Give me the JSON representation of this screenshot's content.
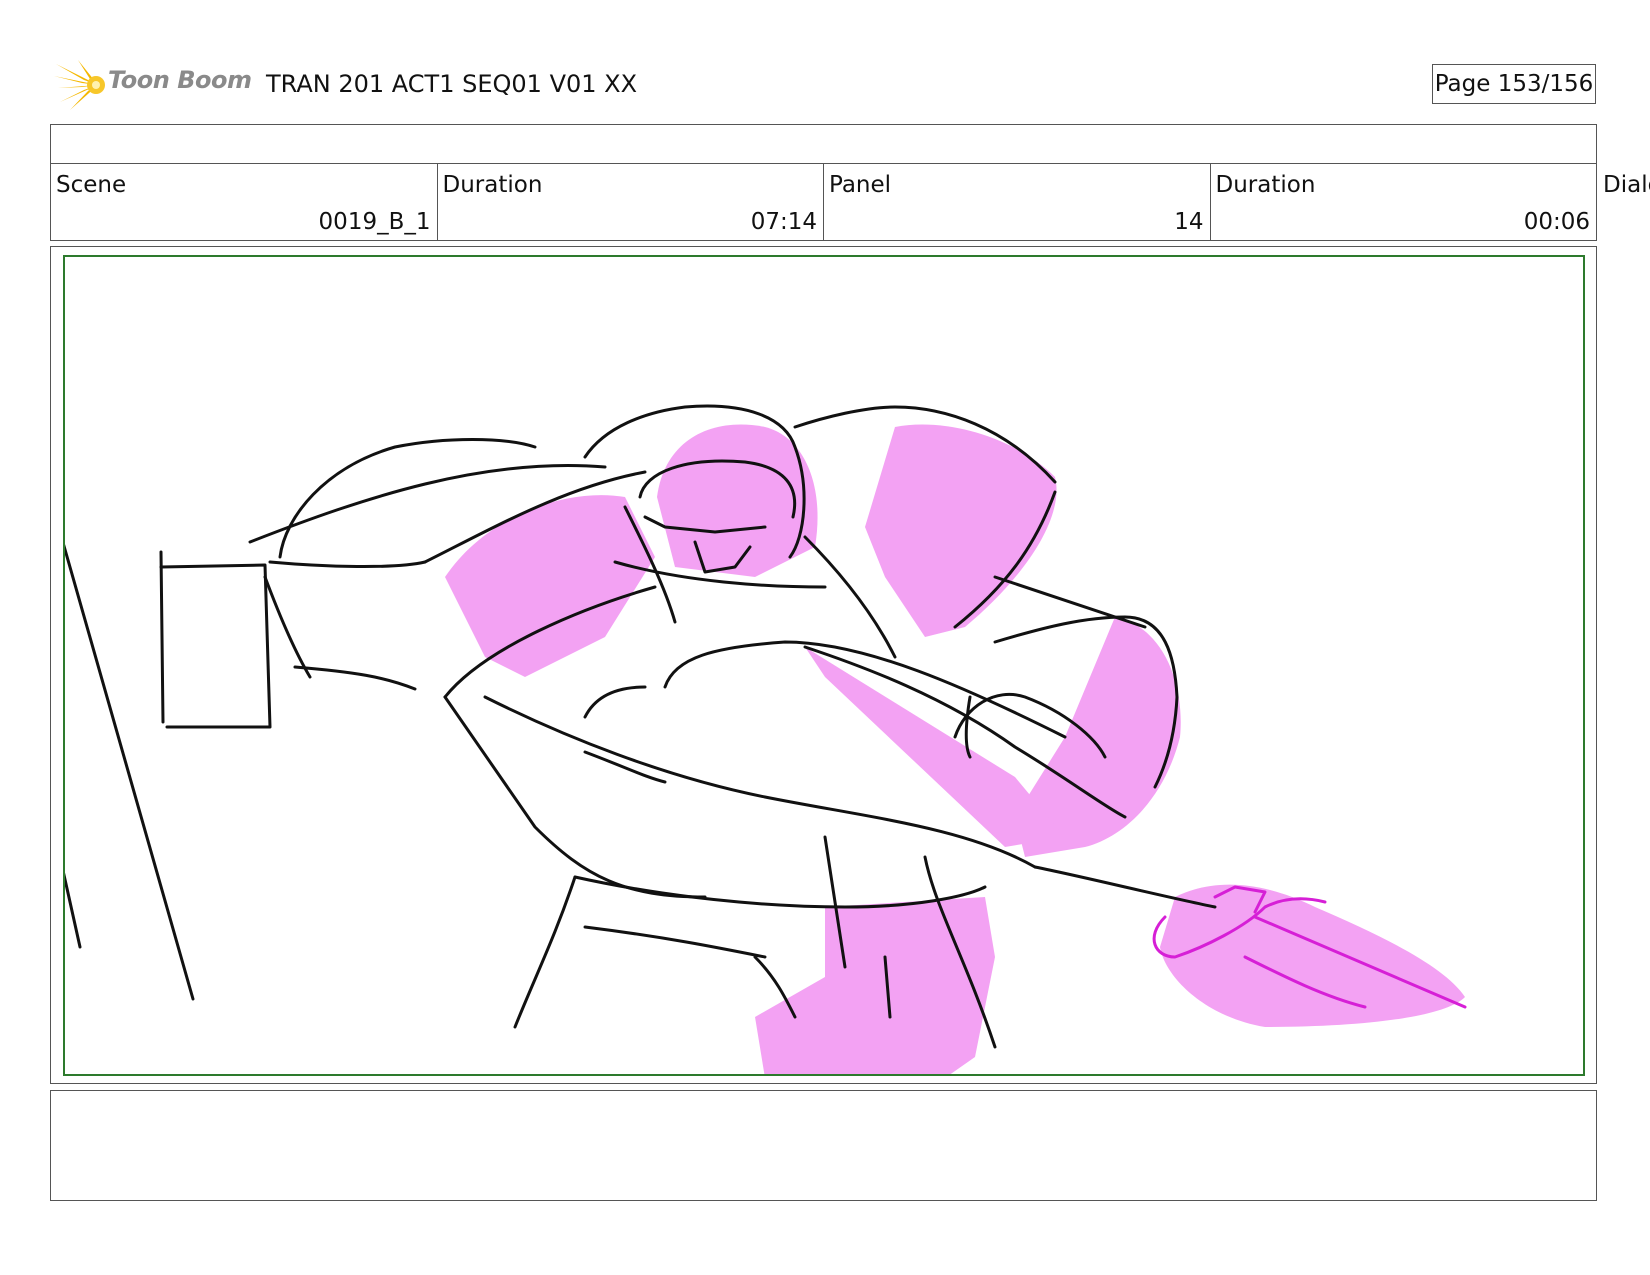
{
  "header": {
    "logo_text": "Toon Boom",
    "title": "TRAN 201 ACT1 SEQ01 V01 XX",
    "page": "Page 153/156"
  },
  "info": {
    "scene_label": "Scene",
    "scene_value": "0019_B_1",
    "scene_duration_label": "Duration",
    "scene_duration_value": "07:14",
    "panel_label": "Panel",
    "panel_value": "14",
    "panel_duration_label": "Duration",
    "panel_duration_value": "00:06",
    "dialog_label": "Dialo"
  },
  "colors": {
    "frame_border": "#2d7a2d",
    "sketch_fill": "#f3a2f3",
    "sketch_line": "#111111",
    "accent_line": "#d61fd6",
    "logo_star": "#f5b800"
  }
}
